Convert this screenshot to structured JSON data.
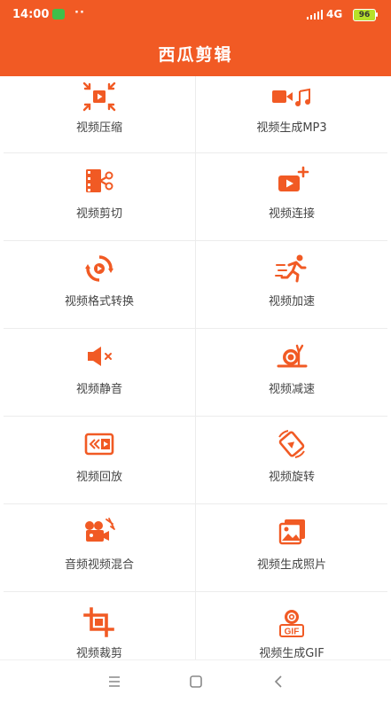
{
  "status_bar": {
    "time": "14:00",
    "network": "4G",
    "battery": "96"
  },
  "app_bar": {
    "title": "西瓜剪辑"
  },
  "accent_color": "#f15a24",
  "tools": [
    {
      "label": "视频压缩",
      "icon": "compress-icon"
    },
    {
      "label": "视频生成MP3",
      "icon": "video-to-mp3-icon"
    },
    {
      "label": "视频剪切",
      "icon": "video-cut-icon"
    },
    {
      "label": "视频连接",
      "icon": "video-join-icon"
    },
    {
      "label": "视频格式转换",
      "icon": "format-convert-icon"
    },
    {
      "label": "视频加速",
      "icon": "speed-up-icon"
    },
    {
      "label": "视频静音",
      "icon": "mute-icon"
    },
    {
      "label": "视频减速",
      "icon": "slow-down-icon"
    },
    {
      "label": "视频回放",
      "icon": "rewind-icon"
    },
    {
      "label": "视频旋转",
      "icon": "rotate-icon"
    },
    {
      "label": "音频视频混合",
      "icon": "audio-video-mix-icon"
    },
    {
      "label": "视频生成照片",
      "icon": "video-to-photo-icon"
    },
    {
      "label": "视频裁剪",
      "icon": "crop-icon"
    },
    {
      "label": "视频生成GIF",
      "icon": "video-to-gif-icon",
      "icon_text": "GIF"
    }
  ],
  "nav_bar": {
    "buttons": [
      "menu-icon",
      "home-icon",
      "back-icon"
    ]
  }
}
